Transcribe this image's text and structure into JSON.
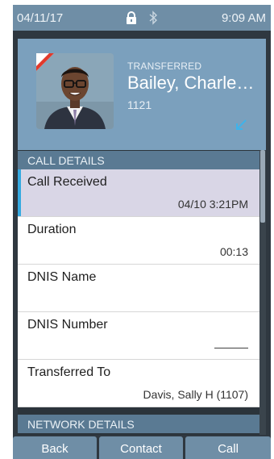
{
  "status_bar": {
    "date": "04/11/17",
    "time": "9:09 AM",
    "lock_icon": "lock-icon",
    "bluetooth_icon": "bluetooth-icon"
  },
  "contact": {
    "status": "TRANSFERRED",
    "name": "Bailey, Charle…",
    "extension": "1121",
    "call_direction_icon": "incoming-arrow-icon",
    "missed_flag_color": "#e23a2c"
  },
  "sections": {
    "call_details": "CALL DETAILS",
    "network_details": "NETWORK DETAILS"
  },
  "call_details": [
    {
      "label": "Call Received",
      "value": "04/10  3:21PM"
    },
    {
      "label": "Duration",
      "value": "00:13"
    },
    {
      "label": "DNIS Name",
      "value": ""
    },
    {
      "label": "DNIS Number",
      "value": "———"
    },
    {
      "label": "Transferred To",
      "value": "Davis, Sally H (1107)"
    }
  ],
  "softkeys": {
    "back": "Back",
    "contact": "Contact",
    "call": "Call"
  },
  "colors": {
    "accent": "#35a9e0",
    "header": "#7ba0bd",
    "section": "#5a7a93",
    "softkey": "#6f8ea6",
    "selected_row": "#d9d6e6"
  }
}
